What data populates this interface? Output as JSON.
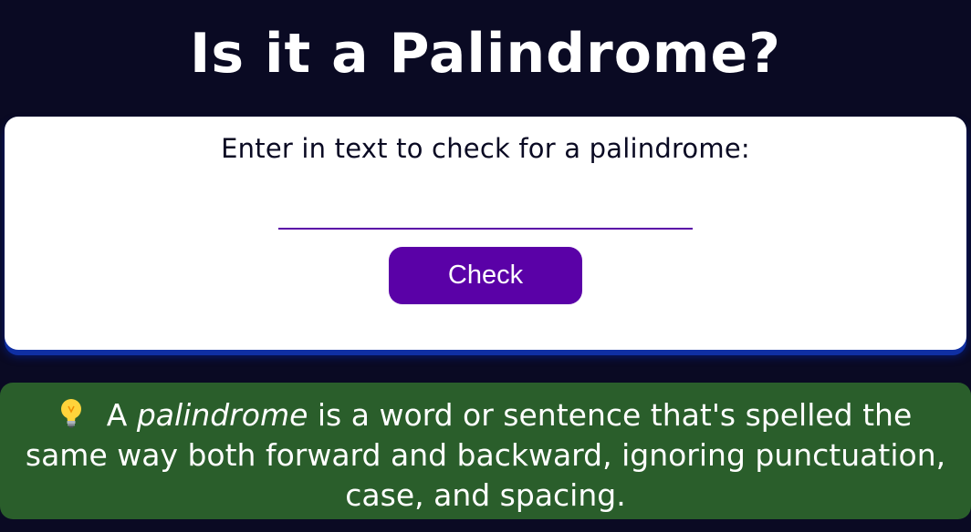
{
  "header": {
    "title": "Is it a Palindrome?"
  },
  "form": {
    "prompt": "Enter in text to check for a palindrome:",
    "input_value": "",
    "input_placeholder": "",
    "check_label": "Check"
  },
  "info": {
    "icon": "lightbulb-icon",
    "lead": "A",
    "term": "palindrome",
    "definition": "is a word or sentence that's spelled the same way both forward and backward, ignoring punctuation, case, and spacing."
  },
  "colors": {
    "background": "#0a0a23",
    "card": "#ffffff",
    "accent": "#5a01a7",
    "info_background": "#2a5e2b",
    "card_shadow": "#0f2fa3"
  }
}
